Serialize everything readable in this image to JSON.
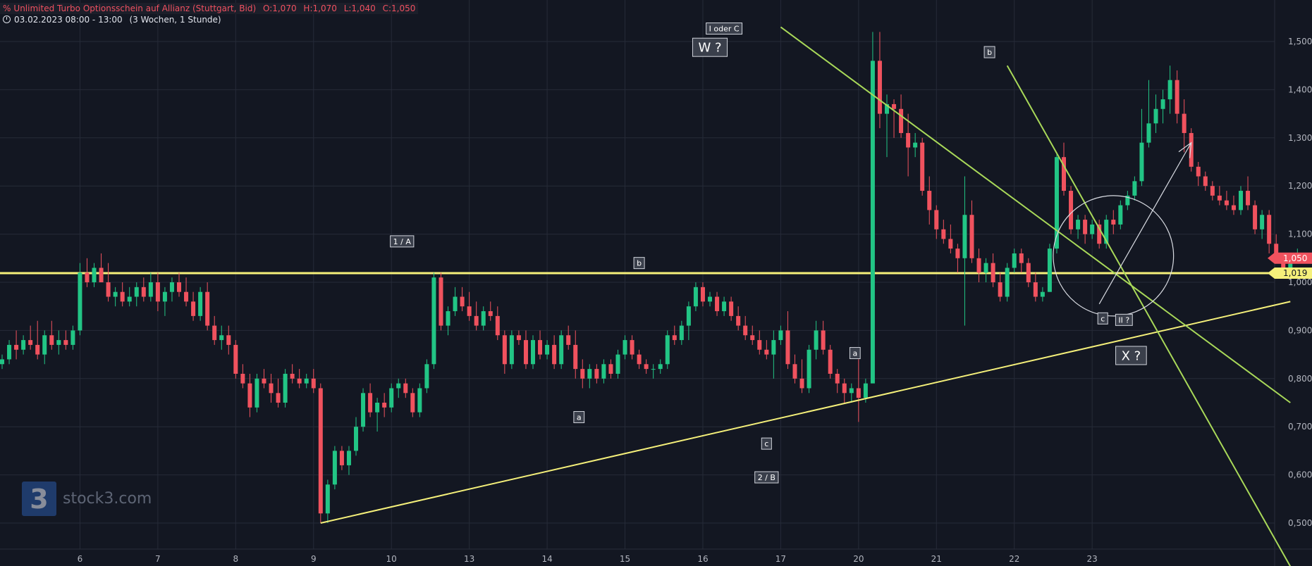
{
  "header": {
    "title": "Unlimited Turbo Optionsschein auf Allianz (Stuttgart, Bid)",
    "ohlc": {
      "o_label": "O:",
      "o": "1,070",
      "h_label": "H:",
      "h": "1,070",
      "l_label": "L:",
      "l": "1,040",
      "c_label": "C:",
      "c": "1,050"
    },
    "timerange": "03.02.2023 08:00 - 13:00",
    "interval": "(3 Wochen, 1 Stunde)"
  },
  "watermark": {
    "symbol": "3",
    "text": "stock3.com"
  },
  "colors": {
    "background": "#131722",
    "grid": "#262b38",
    "up": "#22c585",
    "down": "#f0525e",
    "support": "#f5f07a",
    "trend": "#a9d959",
    "label_bg": "#3a3f4b",
    "text": "#d1d4dc"
  },
  "chart_data": {
    "type": "candlestick",
    "ylim": [
      0.41,
      1.56
    ],
    "y_ticks": [
      "1,500",
      "1,400",
      "1,300",
      "1,200",
      "1,100",
      "1,000",
      "0,900",
      "0,800",
      "0,700",
      "0,600",
      "0,500"
    ],
    "x_ticks": [
      {
        "label": "6",
        "idx": 11
      },
      {
        "label": "7",
        "idx": 22
      },
      {
        "label": "8",
        "idx": 33
      },
      {
        "label": "9",
        "idx": 44
      },
      {
        "label": "10",
        "idx": 55
      },
      {
        "label": "13",
        "idx": 66
      },
      {
        "label": "14",
        "idx": 77
      },
      {
        "label": "15",
        "idx": 88
      },
      {
        "label": "16",
        "idx": 99
      },
      {
        "label": "17",
        "idx": 110
      },
      {
        "label": "20",
        "idx": 121
      },
      {
        "label": "21",
        "idx": 132
      },
      {
        "label": "22",
        "idx": 143
      },
      {
        "label": "23",
        "idx": 154
      }
    ],
    "candles": [
      [
        0.83,
        0.85,
        0.82,
        0.84
      ],
      [
        0.84,
        0.88,
        0.83,
        0.87
      ],
      [
        0.87,
        0.9,
        0.84,
        0.86
      ],
      [
        0.86,
        0.89,
        0.85,
        0.88
      ],
      [
        0.88,
        0.91,
        0.86,
        0.87
      ],
      [
        0.87,
        0.92,
        0.84,
        0.85
      ],
      [
        0.85,
        0.9,
        0.83,
        0.89
      ],
      [
        0.89,
        0.92,
        0.86,
        0.87
      ],
      [
        0.87,
        0.9,
        0.85,
        0.88
      ],
      [
        0.88,
        0.9,
        0.86,
        0.87
      ],
      [
        0.87,
        0.91,
        0.86,
        0.9
      ],
      [
        0.9,
        1.04,
        0.89,
        1.02
      ],
      [
        1.02,
        1.05,
        0.99,
        1.0
      ],
      [
        1.0,
        1.04,
        0.99,
        1.03
      ],
      [
        1.03,
        1.06,
        1.0,
        1.0
      ],
      [
        1.0,
        1.04,
        0.96,
        0.97
      ],
      [
        0.97,
        0.99,
        0.95,
        0.98
      ],
      [
        0.98,
        1.0,
        0.95,
        0.96
      ],
      [
        0.96,
        0.99,
        0.95,
        0.97
      ],
      [
        0.97,
        1.0,
        0.95,
        0.99
      ],
      [
        0.99,
        1.01,
        0.96,
        0.97
      ],
      [
        0.97,
        1.02,
        0.96,
        1.0
      ],
      [
        1.0,
        1.02,
        0.94,
        0.96
      ],
      [
        0.96,
        0.99,
        0.93,
        0.98
      ],
      [
        0.98,
        1.01,
        0.96,
        1.0
      ],
      [
        1.0,
        1.02,
        0.97,
        0.98
      ],
      [
        0.98,
        1.01,
        0.95,
        0.96
      ],
      [
        0.96,
        0.98,
        0.92,
        0.93
      ],
      [
        0.93,
        0.99,
        0.92,
        0.98
      ],
      [
        0.98,
        1.0,
        0.9,
        0.91
      ],
      [
        0.91,
        0.93,
        0.87,
        0.88
      ],
      [
        0.88,
        0.91,
        0.86,
        0.89
      ],
      [
        0.89,
        0.91,
        0.85,
        0.87
      ],
      [
        0.87,
        0.88,
        0.8,
        0.81
      ],
      [
        0.81,
        0.83,
        0.78,
        0.79
      ],
      [
        0.79,
        0.81,
        0.72,
        0.74
      ],
      [
        0.74,
        0.81,
        0.73,
        0.8
      ],
      [
        0.8,
        0.82,
        0.78,
        0.79
      ],
      [
        0.79,
        0.81,
        0.75,
        0.77
      ],
      [
        0.77,
        0.8,
        0.74,
        0.75
      ],
      [
        0.75,
        0.82,
        0.74,
        0.81
      ],
      [
        0.81,
        0.83,
        0.79,
        0.8
      ],
      [
        0.8,
        0.82,
        0.78,
        0.79
      ],
      [
        0.79,
        0.81,
        0.78,
        0.8
      ],
      [
        0.8,
        0.82,
        0.77,
        0.78
      ],
      [
        0.78,
        0.79,
        0.5,
        0.52
      ],
      [
        0.52,
        0.59,
        0.5,
        0.58
      ],
      [
        0.58,
        0.66,
        0.57,
        0.65
      ],
      [
        0.65,
        0.66,
        0.61,
        0.62
      ],
      [
        0.62,
        0.66,
        0.6,
        0.65
      ],
      [
        0.65,
        0.72,
        0.64,
        0.7
      ],
      [
        0.7,
        0.78,
        0.69,
        0.77
      ],
      [
        0.77,
        0.79,
        0.72,
        0.73
      ],
      [
        0.73,
        0.76,
        0.69,
        0.75
      ],
      [
        0.75,
        0.77,
        0.72,
        0.74
      ],
      [
        0.74,
        0.79,
        0.73,
        0.78
      ],
      [
        0.78,
        0.8,
        0.76,
        0.79
      ],
      [
        0.79,
        0.8,
        0.76,
        0.77
      ],
      [
        0.77,
        0.78,
        0.72,
        0.73
      ],
      [
        0.73,
        0.79,
        0.72,
        0.78
      ],
      [
        0.78,
        0.84,
        0.77,
        0.83
      ],
      [
        0.83,
        1.02,
        0.82,
        1.01
      ],
      [
        1.01,
        1.02,
        0.9,
        0.91
      ],
      [
        0.91,
        0.95,
        0.89,
        0.94
      ],
      [
        0.94,
        0.99,
        0.93,
        0.97
      ],
      [
        0.97,
        0.99,
        0.94,
        0.95
      ],
      [
        0.95,
        0.98,
        0.92,
        0.93
      ],
      [
        0.93,
        0.96,
        0.9,
        0.91
      ],
      [
        0.91,
        0.95,
        0.9,
        0.94
      ],
      [
        0.94,
        0.96,
        0.92,
        0.93
      ],
      [
        0.93,
        0.95,
        0.88,
        0.89
      ],
      [
        0.89,
        0.9,
        0.81,
        0.83
      ],
      [
        0.83,
        0.9,
        0.82,
        0.89
      ],
      [
        0.89,
        0.9,
        0.87,
        0.88
      ],
      [
        0.88,
        0.9,
        0.82,
        0.83
      ],
      [
        0.83,
        0.89,
        0.82,
        0.88
      ],
      [
        0.88,
        0.9,
        0.84,
        0.85
      ],
      [
        0.85,
        0.88,
        0.84,
        0.87
      ],
      [
        0.87,
        0.89,
        0.82,
        0.83
      ],
      [
        0.83,
        0.9,
        0.82,
        0.89
      ],
      [
        0.89,
        0.91,
        0.86,
        0.87
      ],
      [
        0.87,
        0.9,
        0.8,
        0.82
      ],
      [
        0.82,
        0.84,
        0.78,
        0.8
      ],
      [
        0.8,
        0.83,
        0.78,
        0.82
      ],
      [
        0.82,
        0.83,
        0.79,
        0.8
      ],
      [
        0.8,
        0.84,
        0.79,
        0.83
      ],
      [
        0.83,
        0.84,
        0.8,
        0.81
      ],
      [
        0.81,
        0.86,
        0.8,
        0.85
      ],
      [
        0.85,
        0.89,
        0.84,
        0.88
      ],
      [
        0.88,
        0.89,
        0.84,
        0.85
      ],
      [
        0.85,
        0.86,
        0.82,
        0.83
      ],
      [
        0.83,
        0.84,
        0.81,
        0.82
      ],
      [
        0.82,
        0.83,
        0.8,
        0.82
      ],
      [
        0.82,
        0.84,
        0.81,
        0.83
      ],
      [
        0.83,
        0.9,
        0.82,
        0.89
      ],
      [
        0.89,
        0.91,
        0.87,
        0.88
      ],
      [
        0.88,
        0.92,
        0.87,
        0.91
      ],
      [
        0.91,
        0.96,
        0.88,
        0.95
      ],
      [
        0.95,
        1.0,
        0.94,
        0.99
      ],
      [
        0.99,
        1.0,
        0.95,
        0.96
      ],
      [
        0.96,
        0.98,
        0.95,
        0.97
      ],
      [
        0.97,
        0.98,
        0.93,
        0.94
      ],
      [
        0.94,
        0.97,
        0.93,
        0.96
      ],
      [
        0.96,
        0.97,
        0.92,
        0.93
      ],
      [
        0.93,
        0.95,
        0.9,
        0.91
      ],
      [
        0.91,
        0.93,
        0.88,
        0.89
      ],
      [
        0.89,
        0.91,
        0.87,
        0.88
      ],
      [
        0.88,
        0.9,
        0.85,
        0.86
      ],
      [
        0.86,
        0.88,
        0.84,
        0.85
      ],
      [
        0.85,
        0.9,
        0.8,
        0.88
      ],
      [
        0.88,
        0.91,
        0.87,
        0.9
      ],
      [
        0.9,
        0.94,
        0.82,
        0.83
      ],
      [
        0.83,
        0.85,
        0.79,
        0.8
      ],
      [
        0.8,
        0.84,
        0.77,
        0.78
      ],
      [
        0.78,
        0.87,
        0.77,
        0.86
      ],
      [
        0.86,
        0.92,
        0.84,
        0.9
      ],
      [
        0.9,
        0.92,
        0.85,
        0.86
      ],
      [
        0.86,
        0.87,
        0.8,
        0.81
      ],
      [
        0.81,
        0.82,
        0.77,
        0.79
      ],
      [
        0.79,
        0.8,
        0.75,
        0.77
      ],
      [
        0.77,
        0.79,
        0.75,
        0.78
      ],
      [
        0.78,
        0.84,
        0.71,
        0.76
      ],
      [
        0.76,
        0.8,
        0.75,
        0.79
      ],
      [
        0.79,
        1.52,
        0.98,
        1.46
      ],
      [
        1.46,
        1.52,
        1.32,
        1.35
      ],
      [
        1.35,
        1.39,
        1.26,
        1.37
      ],
      [
        1.37,
        1.38,
        1.3,
        1.36
      ],
      [
        1.36,
        1.39,
        1.3,
        1.31
      ],
      [
        1.31,
        1.35,
        1.22,
        1.28
      ],
      [
        1.28,
        1.31,
        1.26,
        1.29
      ],
      [
        1.29,
        1.3,
        1.18,
        1.19
      ],
      [
        1.19,
        1.22,
        1.12,
        1.15
      ],
      [
        1.15,
        1.16,
        1.09,
        1.11
      ],
      [
        1.11,
        1.13,
        1.08,
        1.09
      ],
      [
        1.09,
        1.12,
        1.06,
        1.07
      ],
      [
        1.07,
        1.08,
        1.02,
        1.05
      ],
      [
        1.05,
        1.22,
        0.91,
        1.14
      ],
      [
        1.14,
        1.17,
        1.04,
        1.05
      ],
      [
        1.05,
        1.07,
        1.0,
        1.02
      ],
      [
        1.02,
        1.05,
        1.0,
        1.04
      ],
      [
        1.04,
        1.06,
        0.99,
        1.0
      ],
      [
        1.0,
        1.02,
        0.96,
        0.97
      ],
      [
        0.97,
        1.04,
        0.96,
        1.03
      ],
      [
        1.03,
        1.07,
        1.02,
        1.06
      ],
      [
        1.06,
        1.07,
        1.02,
        1.04
      ],
      [
        1.04,
        1.05,
        0.99,
        1.0
      ],
      [
        1.0,
        1.02,
        0.96,
        0.97
      ],
      [
        0.97,
        0.99,
        0.96,
        0.98
      ],
      [
        0.98,
        1.08,
        0.98,
        1.07
      ],
      [
        1.07,
        1.27,
        1.06,
        1.26
      ],
      [
        1.26,
        1.29,
        1.18,
        1.19
      ],
      [
        1.19,
        1.2,
        1.1,
        1.11
      ],
      [
        1.11,
        1.14,
        1.09,
        1.13
      ],
      [
        1.13,
        1.14,
        1.08,
        1.1
      ],
      [
        1.1,
        1.13,
        1.09,
        1.12
      ],
      [
        1.12,
        1.13,
        1.07,
        1.08
      ],
      [
        1.08,
        1.14,
        1.07,
        1.13
      ],
      [
        1.13,
        1.15,
        1.1,
        1.12
      ],
      [
        1.12,
        1.17,
        1.11,
        1.16
      ],
      [
        1.16,
        1.19,
        1.15,
        1.18
      ],
      [
        1.18,
        1.22,
        1.17,
        1.21
      ],
      [
        1.21,
        1.36,
        1.2,
        1.29
      ],
      [
        1.29,
        1.42,
        1.28,
        1.33
      ],
      [
        1.33,
        1.39,
        1.31,
        1.36
      ],
      [
        1.36,
        1.4,
        1.33,
        1.38
      ],
      [
        1.38,
        1.45,
        1.35,
        1.42
      ],
      [
        1.42,
        1.44,
        1.33,
        1.35
      ],
      [
        1.35,
        1.38,
        1.27,
        1.31
      ],
      [
        1.31,
        1.32,
        1.23,
        1.24
      ],
      [
        1.24,
        1.25,
        1.2,
        1.22
      ],
      [
        1.22,
        1.23,
        1.19,
        1.2
      ],
      [
        1.2,
        1.21,
        1.17,
        1.18
      ],
      [
        1.18,
        1.2,
        1.16,
        1.17
      ],
      [
        1.17,
        1.19,
        1.15,
        1.16
      ],
      [
        1.16,
        1.18,
        1.14,
        1.15
      ],
      [
        1.15,
        1.2,
        1.14,
        1.19
      ],
      [
        1.19,
        1.22,
        1.15,
        1.16
      ],
      [
        1.16,
        1.17,
        1.1,
        1.11
      ],
      [
        1.11,
        1.15,
        1.09,
        1.14
      ],
      [
        1.14,
        1.15,
        1.06,
        1.08
      ],
      [
        1.08,
        1.1,
        1.04,
        1.05
      ],
      [
        1.05,
        1.06,
        1.01,
        1.02
      ],
      [
        1.02,
        1.05,
        1.01,
        1.04
      ],
      [
        1.04,
        1.07,
        1.04,
        1.05
      ]
    ],
    "support_line": {
      "y": 1.019,
      "label": "1,019"
    },
    "last_price": {
      "y": 1.05,
      "label": "1,050"
    },
    "trendlines": [
      {
        "kind": "support",
        "from": [
          45,
          0.5
        ],
        "to": [
          182,
          0.96
        ]
      },
      {
        "kind": "resistance",
        "from": [
          110,
          1.53
        ],
        "to": [
          182,
          0.75
        ]
      },
      {
        "kind": "resistance",
        "from": [
          142,
          1.45
        ],
        "to": [
          182,
          0.41
        ]
      }
    ],
    "wave_labels": [
      {
        "text": "1 / A",
        "idx": 56.5,
        "y": 1.085,
        "size": "s"
      },
      {
        "text": "I oder C",
        "idx": 102,
        "y": 1.527,
        "size": "s"
      },
      {
        "text": "W ?",
        "idx": 100,
        "y": 1.488,
        "size": "l"
      },
      {
        "text": "b",
        "idx": 90,
        "y": 1.04,
        "size": "s"
      },
      {
        "text": "a",
        "idx": 81.5,
        "y": 0.72,
        "size": "s"
      },
      {
        "text": "c",
        "idx": 108,
        "y": 0.665,
        "size": "s"
      },
      {
        "text": "2 / B",
        "idx": 108,
        "y": 0.595,
        "size": "s"
      },
      {
        "text": "a",
        "idx": 120.5,
        "y": 0.853,
        "size": "s"
      },
      {
        "text": "b",
        "idx": 139.5,
        "y": 1.478,
        "size": "s"
      },
      {
        "text": "c",
        "idx": 155.5,
        "y": 0.925,
        "size": "s"
      },
      {
        "text": "II ?",
        "idx": 158.5,
        "y": 0.922,
        "size": "s"
      },
      {
        "text": "X ?",
        "idx": 159.5,
        "y": 0.848,
        "size": "l"
      }
    ],
    "annotations": [
      {
        "kind": "ellipse",
        "center": [
          157,
          1.055
        ],
        "r_idx": 8.5,
        "r_y": 0.125
      },
      {
        "kind": "arrow",
        "from": [
          155,
          0.955
        ],
        "to": [
          168,
          1.29
        ]
      }
    ]
  }
}
